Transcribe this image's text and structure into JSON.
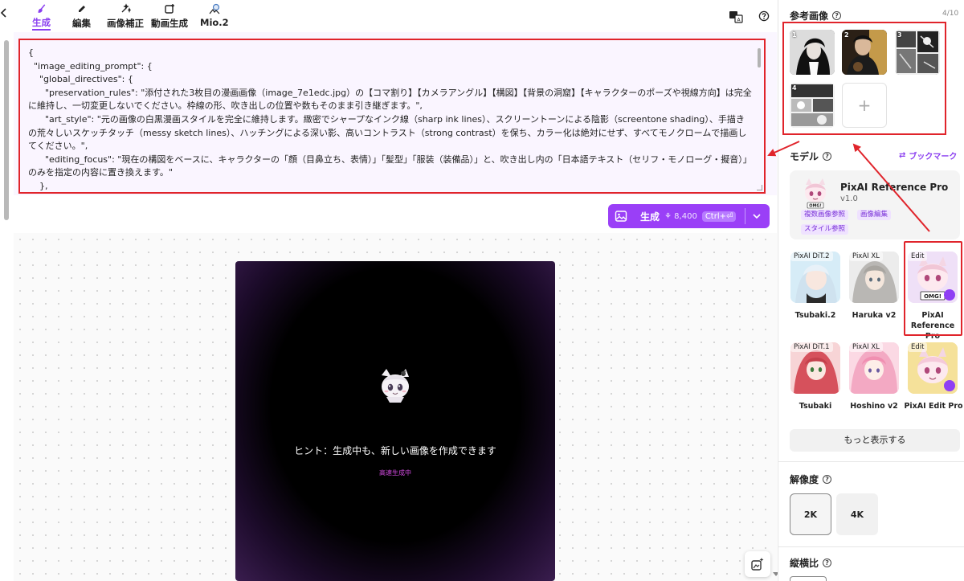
{
  "tabs": [
    {
      "label": "生成",
      "icon": "brush-icon",
      "active": true
    },
    {
      "label": "編集",
      "icon": "pencil-icon",
      "active": false
    },
    {
      "label": "画像補正",
      "icon": "sparkle-wand-icon",
      "active": false
    },
    {
      "label": "動画生成",
      "icon": "video-plus-icon",
      "active": false
    },
    {
      "label": "Mio.2",
      "icon": "mio-icon",
      "active": false
    }
  ],
  "prompt": {
    "text": "{\n  \"image_editing_prompt\": {\n    \"global_directives\": {\n      \"preservation_rules\": \"添付された3枚目の漫画画像（image_7e1edc.jpg）の【コマ割り】【カメラアングル】【構図】【背景の洞窟】【キャラクターのポーズや視線方向】は完全に維持し、一切変更しないでください。枠線の形、吹き出しの位置や数もそのまま引き継ぎます。\",\n      \"art_style\": \"元の画像の白黒漫画スタイルを完全に維持します。緻密でシャープなインク線（sharp ink lines）、スクリーントーンによる陰影（screentone shading）、手描きの荒々しいスケッチタッチ（messy sketch lines）、ハッチングによる深い影、高いコントラスト（strong contrast）を保ち、カラー化は絶対にせず、すべてモノクロームで描画してください。\",\n      \"editing_focus\": \"現在の構図をベースに、キャラクターの「顔（目鼻立ち、表情）」「髪型」「服装（装備品）」と、吹き出し内の「日本語テキスト（セリフ・モノローグ・擬音）」のみを指定の内容に置き換えます。\"\n    },\n    \"character_profiles\": {"
  },
  "generate": {
    "label": "生成",
    "cost": "8,400",
    "shortcut": "Ctrl+⏎"
  },
  "preview": {
    "hint": "ヒント：生成中も、新しい画像を作成できます",
    "status": "高速生成中"
  },
  "sidebar": {
    "reference_title": "参考画像",
    "reference_count": "4/10",
    "reference_images": [
      "1",
      "2",
      "3",
      "4"
    ],
    "model_title": "モデル",
    "bookmark_label": "ブックマーク",
    "selected_model": {
      "name": "PixAI Reference Pro",
      "version": "v1.0",
      "tags": [
        "複数画像参照",
        "画像編集",
        "スタイル参照"
      ]
    },
    "models": [
      {
        "badge": "PixAI DiT.2",
        "label": "Tsubaki.2"
      },
      {
        "badge": "PixAI XL",
        "label": "Haruka v2"
      },
      {
        "badge": "Edit",
        "label": "PixAI Reference Pro"
      },
      {
        "badge": "PixAI DiT.1",
        "label": "Tsubaki"
      },
      {
        "badge": "PixAI XL",
        "label": "Hoshino v2"
      },
      {
        "badge": "Edit",
        "label": "PixAI Edit Pro"
      }
    ],
    "more_label": "もっと表示する",
    "resolution_title": "解像度",
    "resolutions": [
      "2K",
      "4K"
    ],
    "aspect_title": "縦横比"
  },
  "colors": {
    "accent": "#9a3ff7",
    "annotation_red": "#e0242b"
  }
}
